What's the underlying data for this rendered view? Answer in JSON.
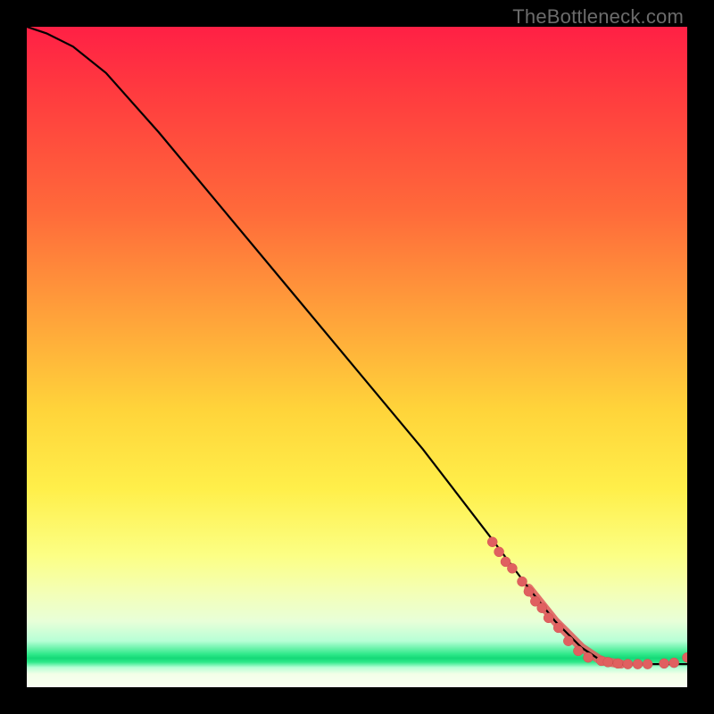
{
  "watermark": "TheBottleneck.com",
  "chart_data": {
    "type": "line",
    "title": "",
    "xlabel": "",
    "ylabel": "",
    "xlim": [
      0,
      100
    ],
    "ylim": [
      0,
      100
    ],
    "curve": [
      {
        "x": 0,
        "y": 100
      },
      {
        "x": 3,
        "y": 99
      },
      {
        "x": 7,
        "y": 97
      },
      {
        "x": 12,
        "y": 93
      },
      {
        "x": 20,
        "y": 84
      },
      {
        "x": 30,
        "y": 72
      },
      {
        "x": 40,
        "y": 60
      },
      {
        "x": 50,
        "y": 48
      },
      {
        "x": 60,
        "y": 36
      },
      {
        "x": 70,
        "y": 23
      },
      {
        "x": 76,
        "y": 15
      },
      {
        "x": 80,
        "y": 10
      },
      {
        "x": 84,
        "y": 6
      },
      {
        "x": 87,
        "y": 4
      },
      {
        "x": 90,
        "y": 3.5
      },
      {
        "x": 95,
        "y": 3.5
      },
      {
        "x": 100,
        "y": 3.5
      }
    ],
    "highlight_segment_start_index": 10,
    "scatter_points": [
      {
        "x": 70.5,
        "y": 22.0
      },
      {
        "x": 71.5,
        "y": 20.5
      },
      {
        "x": 72.5,
        "y": 19.0
      },
      {
        "x": 73.5,
        "y": 18.0
      },
      {
        "x": 75.0,
        "y": 16.0
      },
      {
        "x": 76.0,
        "y": 14.5
      },
      {
        "x": 77.0,
        "y": 13.0
      },
      {
        "x": 78.0,
        "y": 12.0
      },
      {
        "x": 79.0,
        "y": 10.5
      },
      {
        "x": 80.5,
        "y": 9.0
      },
      {
        "x": 82.0,
        "y": 7.0
      },
      {
        "x": 83.5,
        "y": 5.5
      },
      {
        "x": 85.0,
        "y": 4.5
      },
      {
        "x": 87.0,
        "y": 4.0
      },
      {
        "x": 88.0,
        "y": 3.8
      },
      {
        "x": 89.5,
        "y": 3.6
      },
      {
        "x": 91.0,
        "y": 3.5
      },
      {
        "x": 92.5,
        "y": 3.5
      },
      {
        "x": 94.0,
        "y": 3.5
      },
      {
        "x": 96.5,
        "y": 3.6
      },
      {
        "x": 98.0,
        "y": 3.7
      },
      {
        "x": 100.0,
        "y": 4.5
      }
    ],
    "gradient_stops_percent": {
      "red": 0,
      "orange": 40,
      "yellow": 70,
      "pale": 88,
      "green_band": 95,
      "bottom": 100
    }
  }
}
